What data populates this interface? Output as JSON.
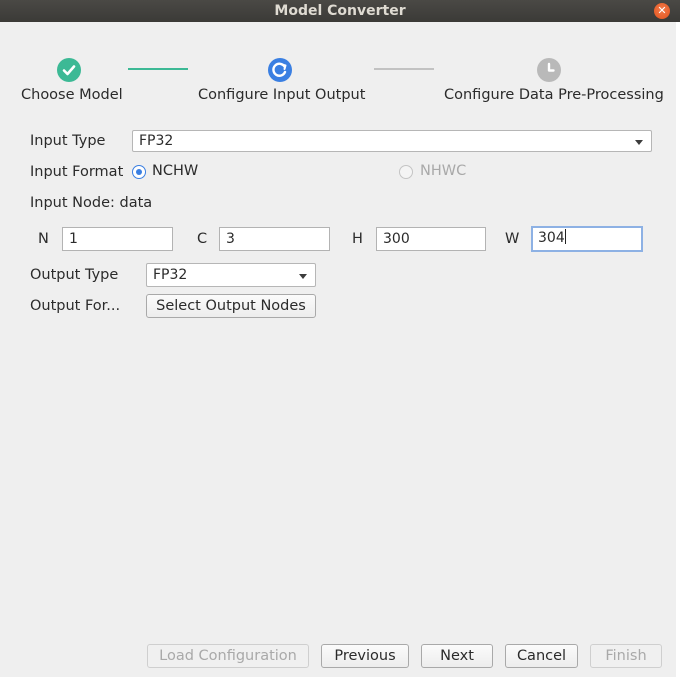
{
  "window": {
    "title": "Model Converter",
    "close_glyph": "✕"
  },
  "steps": [
    {
      "label": "Choose Model",
      "state": "done",
      "icon": "check-icon"
    },
    {
      "label": "Configure Input  Output",
      "state": "current",
      "icon": "refresh-icon"
    },
    {
      "label": "Configure Data Pre-Processing",
      "state": "pending",
      "icon": "clock-icon"
    }
  ],
  "colors": {
    "done": "#3cb995",
    "current": "#3a7fe2",
    "pending": "#b9b9b9"
  },
  "form": {
    "input_type_label": "Input Type",
    "input_type_value": "FP32",
    "input_format_label": "Input Format",
    "format_options": [
      {
        "label": "NCHW",
        "selected": true
      },
      {
        "label": "NHWC",
        "selected": false,
        "disabled": true
      }
    ],
    "input_node_label": "Input Node: data",
    "dims": [
      {
        "label": "N",
        "value": "1"
      },
      {
        "label": "C",
        "value": "3"
      },
      {
        "label": "H",
        "value": "300"
      },
      {
        "label": "W",
        "value": "304"
      }
    ],
    "output_type_label": "Output Type",
    "output_type_value": "FP32",
    "output_format_label": "Output For...",
    "select_output_nodes_label": "Select Output Nodes"
  },
  "footer": {
    "load_configuration": "Load Configuration",
    "previous": "Previous",
    "next": "Next",
    "cancel": "Cancel",
    "finish": "Finish"
  }
}
